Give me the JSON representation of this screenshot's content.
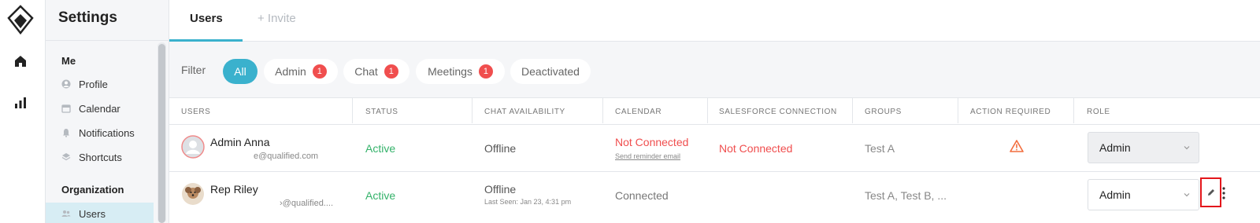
{
  "app": {
    "settings_title": "Settings"
  },
  "sidebar": {
    "sections": [
      {
        "label": "Me"
      },
      {
        "label": "Organization"
      }
    ],
    "items": [
      {
        "label": "Profile",
        "icon": "user-circle-icon"
      },
      {
        "label": "Calendar",
        "icon": "calendar-icon"
      },
      {
        "label": "Notifications",
        "icon": "bell-icon"
      },
      {
        "label": "Shortcuts",
        "icon": "layers-icon"
      },
      {
        "label": "Users",
        "icon": "users-icon",
        "active": true
      }
    ]
  },
  "rail": {
    "items": [
      "logo",
      "home-icon",
      "bar-chart-icon"
    ]
  },
  "tabs": [
    {
      "label": "Users",
      "active": true
    },
    {
      "label": "+ Invite",
      "active": false
    }
  ],
  "filter": {
    "label": "Filter",
    "pills": [
      {
        "label": "All",
        "active": true,
        "badge": ""
      },
      {
        "label": "Admin",
        "active": false,
        "badge": "1"
      },
      {
        "label": "Chat",
        "active": false,
        "badge": "1"
      },
      {
        "label": "Meetings",
        "active": false,
        "badge": "1"
      },
      {
        "label": "Deactivated",
        "active": false,
        "badge": ""
      }
    ]
  },
  "table": {
    "columns": [
      "USERS",
      "STATUS",
      "CHAT AVAILABILITY",
      "CALENDAR",
      "SALESFORCE CONNECTION",
      "GROUPS",
      "ACTION REQUIRED",
      "ROLE"
    ],
    "rows": [
      {
        "name": "Admin Anna",
        "email": "e@qualified.com",
        "status": "Active",
        "chat": "Offline",
        "chat_sub": "",
        "calendar": "Not Connected",
        "calendar_sub": "Send reminder email",
        "salesforce": "Not Connected",
        "groups": "Test A",
        "action_required": "warning-icon",
        "role": "Admin"
      },
      {
        "name": "Rep Riley",
        "email": "›@qualified....",
        "status": "Active",
        "chat": "Offline",
        "chat_sub": "Last Seen: Jan 23, 4:31 pm",
        "calendar": "Connected",
        "calendar_sub": "",
        "salesforce": "",
        "groups": "Test A, Test B, ...",
        "action_required": "",
        "role": "Admin"
      }
    ]
  },
  "colors": {
    "accent": "#3ab1cd",
    "active_green": "#34b26a",
    "alert_red": "#f04e4e",
    "highlight_border": "#e3161b"
  }
}
